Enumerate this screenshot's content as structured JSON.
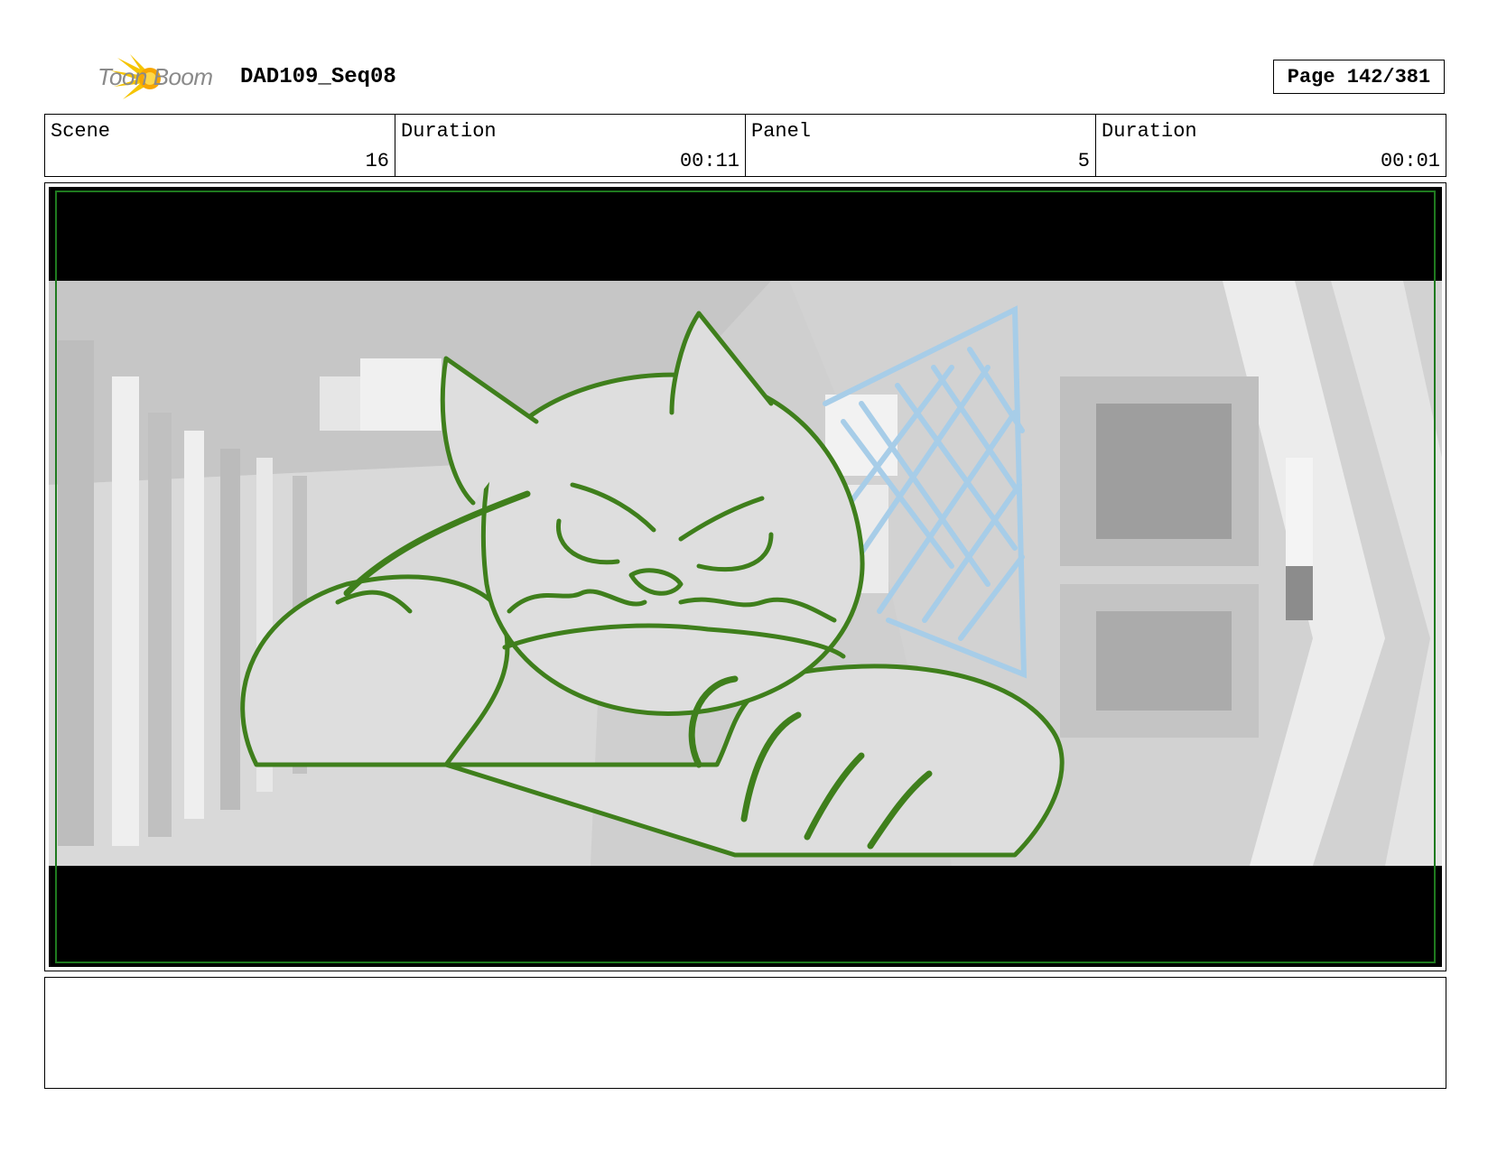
{
  "header": {
    "logo_text": "Toon Boom",
    "sequence": "DAD109_Seq08",
    "page_label": "Page 142/381"
  },
  "info": {
    "scene_label": "Scene",
    "scene_value": "16",
    "scene_duration_label": "Duration",
    "scene_duration_value": "00:11",
    "panel_label": "Panel",
    "panel_value": "5",
    "panel_duration_label": "Duration",
    "panel_duration_value": "00:01"
  },
  "panel": {
    "drawing": "angry cat character leaning forward in corridor",
    "colors": {
      "sketch": "#3f7f1c",
      "net": "#a7cde8",
      "letterbox": "#000000",
      "safe_frame": "#1f7a1f"
    }
  },
  "notes": {
    "text": ""
  }
}
